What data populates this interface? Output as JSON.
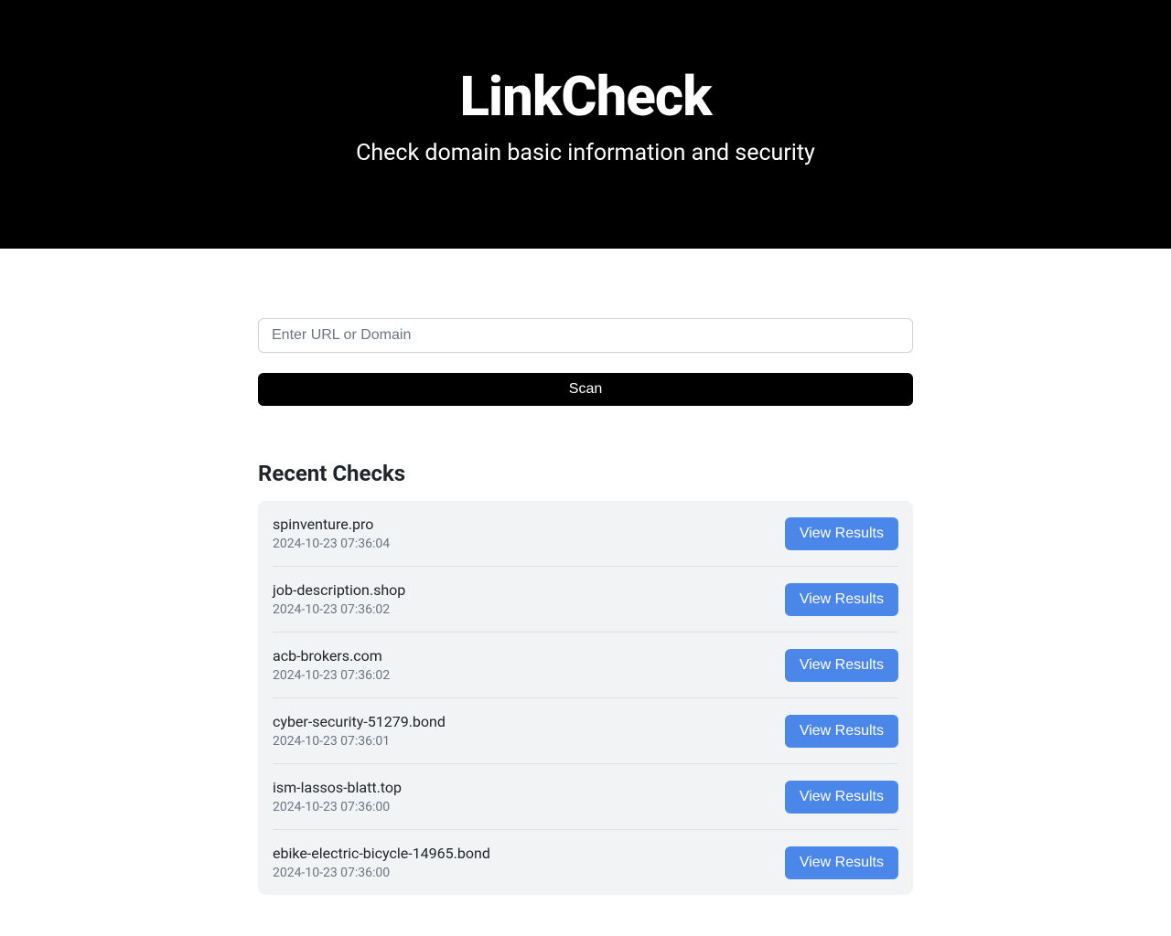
{
  "hero": {
    "title": "LinkCheck",
    "subtitle": "Check domain basic information and security"
  },
  "search": {
    "placeholder": "Enter URL or Domain",
    "value": "",
    "scan_label": "Scan"
  },
  "recent": {
    "heading": "Recent Checks",
    "view_label": "View Results",
    "items": [
      {
        "domain": "spinventure.pro",
        "timestamp": "2024-10-23 07:36:04"
      },
      {
        "domain": "job-description.shop",
        "timestamp": "2024-10-23 07:36:02"
      },
      {
        "domain": "acb-brokers.com",
        "timestamp": "2024-10-23 07:36:02"
      },
      {
        "domain": "cyber-security-51279.bond",
        "timestamp": "2024-10-23 07:36:01"
      },
      {
        "domain": "ism-lassos-blatt.top",
        "timestamp": "2024-10-23 07:36:00"
      },
      {
        "domain": "ebike-electric-bicycle-14965.bond",
        "timestamp": "2024-10-23 07:36:00"
      }
    ]
  }
}
